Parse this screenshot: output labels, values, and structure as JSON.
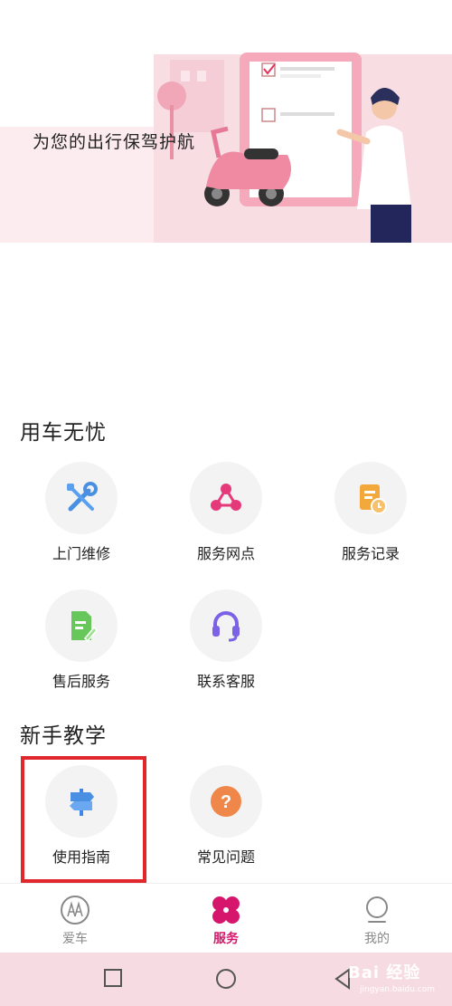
{
  "banner": {
    "slogan": "为您的出行保驾护航"
  },
  "sections": [
    {
      "title": "用车无忧"
    },
    {
      "title": "新手教学"
    }
  ],
  "services": {
    "onsite_repair": "上门维修",
    "service_outlets": "服务网点",
    "service_records": "服务记录",
    "after_sales": "售后服务",
    "contact_support": "联系客服",
    "user_guide": "使用指南",
    "faq": "常见问题"
  },
  "nav": {
    "car": "爱车",
    "service": "服务",
    "me": "我的",
    "active_color": "#d6156c",
    "inactive_color": "#888888"
  },
  "watermark": {
    "text": "Bai 经验",
    "sub": "jingyan.baidu.com"
  }
}
